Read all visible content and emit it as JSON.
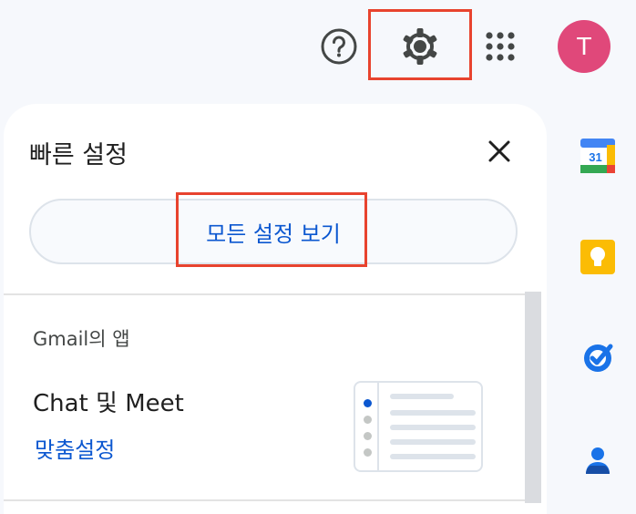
{
  "topbar": {
    "avatar_initial": "T"
  },
  "quick_settings": {
    "title": "빠른 설정",
    "all_settings_label": "모든 설정 보기",
    "section_label": "Gmail의 앱",
    "chat_meet_title": "Chat 및 Meet",
    "customize_label": "맞춤설정"
  },
  "side_panel": {
    "calendar_number": "31"
  },
  "colors": {
    "highlight": "#e8432e",
    "link_blue": "#0b57d0",
    "avatar": "#e0487a"
  }
}
